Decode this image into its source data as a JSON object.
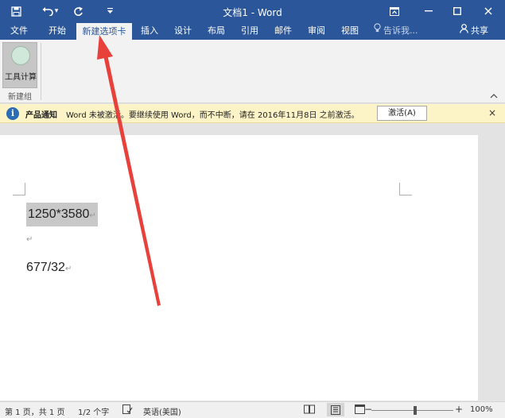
{
  "titlebar": {
    "title": "文档1 - Word",
    "save_icon": "save-icon",
    "undo_icon": "undo-icon",
    "undo_menu": "▾",
    "redo_icon": "redo-icon",
    "customize_icon": "customize-quick-access-icon",
    "ribbon_display_icon": "ribbon-display-icon",
    "minimize_icon": "minimize-icon",
    "maximize_icon": "maximize-icon",
    "close_icon": "close-icon"
  },
  "tabs": [
    {
      "label": "文件"
    },
    {
      "label": "开始"
    },
    {
      "label": "新建选项卡",
      "active": true
    },
    {
      "label": "插入"
    },
    {
      "label": "设计"
    },
    {
      "label": "布局"
    },
    {
      "label": "引用"
    },
    {
      "label": "邮件"
    },
    {
      "label": "审阅"
    },
    {
      "label": "视图"
    }
  ],
  "tellme": {
    "placeholder": "告诉我...",
    "icon": "lightbulb-icon"
  },
  "share": {
    "label": "共享",
    "icon": "person-icon"
  },
  "ribbon": {
    "button_label": "工具计算",
    "button_icon": "circle-icon",
    "group_label": "新建组",
    "collapse_icon": "chevron-up-icon"
  },
  "notification": {
    "icon": "info-icon",
    "title": "产品通知",
    "message": "Word 未被激活。要继续使用 Word，而不中断，请在 2016年11月8日 之前激活。",
    "button_label": "激活(A)",
    "close_glyph": "×"
  },
  "document": {
    "line1": "1250*3580",
    "line3": "677/32",
    "paragraph_mark": "↵"
  },
  "status": {
    "page": "第 1 页，共 1 页",
    "words": "1/2 个字",
    "language": "英语(美国)",
    "zoom": "100%",
    "zoom_minus": "−",
    "zoom_plus": "+",
    "proofing_icon": "proofing-icon",
    "read_mode_icon": "read-mode-icon",
    "print_layout_icon": "print-layout-icon",
    "web_layout_icon": "web-layout-icon"
  },
  "colors": {
    "accent": "#2b579a",
    "notification_bg": "#fcf3c7",
    "arrow": "#e8413c"
  }
}
